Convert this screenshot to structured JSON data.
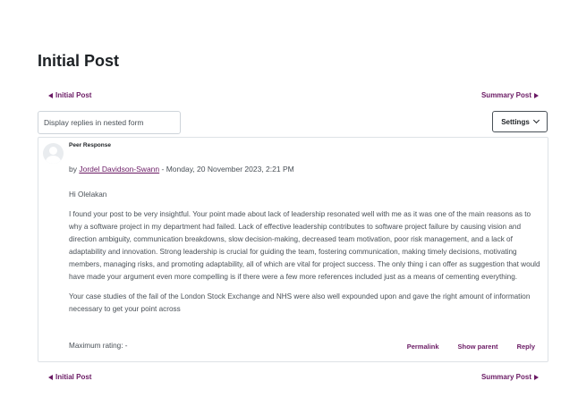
{
  "page": {
    "title": "Initial Post"
  },
  "nav_top": {
    "prev_label": "Initial Post",
    "next_label": "Summary Post"
  },
  "controls": {
    "display_mode": "Display replies in nested form",
    "settings_label": "Settings"
  },
  "post": {
    "subject": "Peer Response",
    "by_prefix": "by",
    "author": "Jordel Davidson-Swann",
    "date_text": "- Monday, 20 November 2023, 2:21 PM",
    "greeting": "Hi Olelakan",
    "paragraph1": "I found your post to be very insightful. Your point made about lack of leadership resonated well with me as it was one of the main reasons as to why a software project in my department had failed. Lack of effective leadership contributes to software project failure by causing vision and direction ambiguity, communication breakdowns, slow decision-making, decreased team motivation, poor risk management, and a lack of adaptability and innovation. Strong leadership is crucial for guiding the team, fostering communication, making timely decisions, motivating members, managing risks, and promoting adaptability, all of which are vital for project success. The only thing i can offer as suggestion that would have made your argument even more compelling is if there were a few more references included just as a means of cementing everything.",
    "paragraph2": "Your case studies of the fail of the London Stock Exchange and NHS were also well expounded upon and gave the right amount of information necessary to get your point across",
    "rating": "Maximum rating: -",
    "actions": {
      "permalink": "Permalink",
      "show_parent": "Show parent",
      "reply": "Reply"
    }
  },
  "nav_bottom": {
    "prev_label": "Initial Post",
    "next_label": "Summary Post"
  },
  "colors": {
    "link": "#6a1a64",
    "text": "#495057",
    "heading": "#1d2125",
    "border": "#dee2e6"
  },
  "icons": {
    "prev": "triangle-left-icon",
    "next": "triangle-right-icon",
    "settings": "chevron-down-icon",
    "avatar": "user-avatar-icon"
  }
}
